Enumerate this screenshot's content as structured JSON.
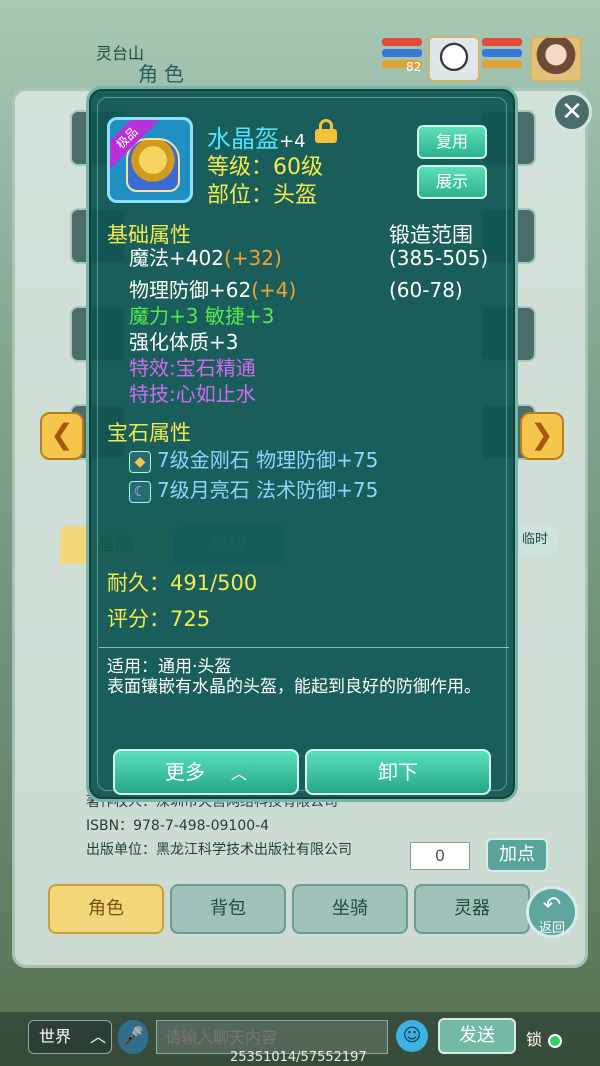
{
  "top": {
    "location": "灵台山",
    "panel_title": "角色",
    "pet_level": "82"
  },
  "arrows": {
    "left": "❮",
    "right": "❯"
  },
  "close_label": "✕",
  "bg_tabs": {
    "basic": "基础",
    "advanced": "高级",
    "temp": "临时"
  },
  "copyright": {
    "line1": "著作权人：深圳市天宫网络科技有限公司",
    "line2": "ISBN：978-7-498-09100-4",
    "line3": "出版单位：黑龙江科学技术出版社有限公司"
  },
  "attr": {
    "input_value": "0",
    "add_point": "加点"
  },
  "bottom_tabs": [
    "角色",
    "背包",
    "坐骑",
    "灵器"
  ],
  "back_label": "返回",
  "chat": {
    "channel": "世界",
    "placeholder": "请输入聊天内容",
    "send": "发送",
    "lock": "锁"
  },
  "coords": "25351014/57552197",
  "item": {
    "quality_tag": "极品",
    "name": "水晶盔",
    "enhance": "+4",
    "level_label": "等级：60级",
    "slot_label": "部位：头盔",
    "reuse_button": "复用",
    "show_button": "展示",
    "base_title": "基础属性",
    "forge_title": "锻造范围",
    "attrs": [
      {
        "name": "魔法+402",
        "bonus": "(+32)",
        "range": "(385-505)"
      },
      {
        "name": "物理防御+62",
        "bonus": "(+4)",
        "range": "(60-78)"
      }
    ],
    "extra": "魔力+3 敏捷+3",
    "strengthen": "强化体质+3",
    "special_effect": "特效:宝石精通",
    "special_skill": "特技:心如止水",
    "gem_title": "宝石属性",
    "gems": [
      "7级金刚石 物理防御+75",
      "7级月亮石 法术防御+75"
    ],
    "durability": "耐久：491/500",
    "score": "评分：725",
    "usage": "适用：通用·头盔",
    "description": "表面镶嵌有水晶的头盔，能起到良好的防御作用。",
    "more_button": "更多",
    "unequip_button": "卸下"
  }
}
